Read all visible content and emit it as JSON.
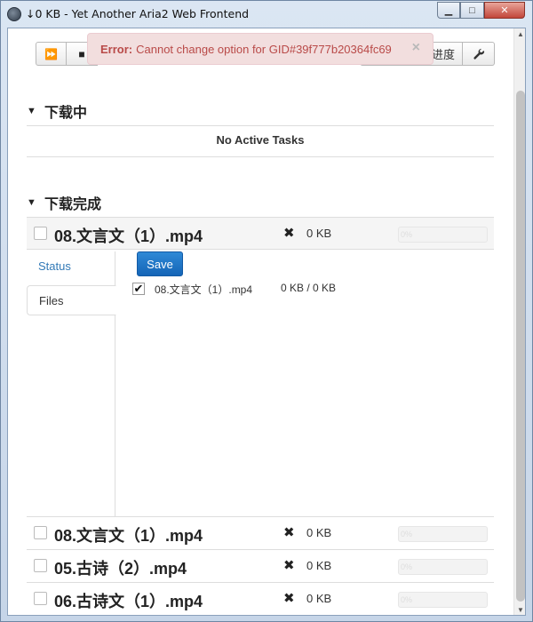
{
  "window": {
    "title": "↓0 KB - Yet Another Aria2 Web Frontend",
    "min_label": "▁",
    "max_label": "□",
    "close_label": "✕"
  },
  "toolbar": {
    "buttons": [
      {
        "icon": "fast-forward-icon",
        "glyph": "⏩"
      },
      {
        "icon": "stop-icon",
        "glyph": "■"
      }
    ],
    "progress_label": "进度",
    "settings_icon": "wrench-icon",
    "settings_glyph": "🔧"
  },
  "alert": {
    "prefix": "Error:",
    "message": "Cannot change option for GID#39f777b20364fc69",
    "close": "×"
  },
  "sections": {
    "active": {
      "title": "下载中",
      "empty_text": "No Active Tasks"
    },
    "completed": {
      "title": "下载完成"
    }
  },
  "tasks": [
    {
      "name": "08.文言文（1）.mp4",
      "size": "0 KB",
      "progress": "0%"
    },
    {
      "name": "08.文言文（1）.mp4",
      "size": "0 KB",
      "progress": "0%"
    },
    {
      "name": "05.古诗（2）.mp4",
      "size": "0 KB",
      "progress": "0%"
    },
    {
      "name": "06.古诗文（1）.mp4",
      "size": "0 KB",
      "progress": "0%"
    }
  ],
  "detail": {
    "tabs": [
      "Status",
      "Files"
    ],
    "save_label": "Save",
    "file": {
      "name": "08.文言文（1）.mp4",
      "size": "0 KB / 0 KB",
      "checked_glyph": "✔"
    }
  },
  "colors": {
    "accent": "#337ab7",
    "error_bg": "#f2dede",
    "error_text": "#b94a48",
    "save_btn": "#1e73c4"
  }
}
